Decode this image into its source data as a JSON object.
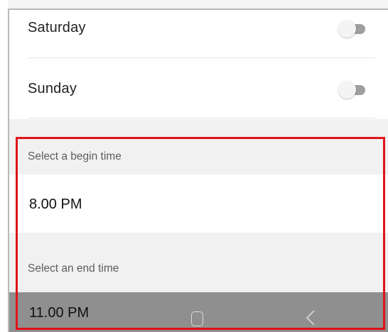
{
  "days": [
    {
      "label": "Saturday",
      "enabled": false,
      "toggle_icon": "toggle-off-icon"
    },
    {
      "label": "Sunday",
      "enabled": false,
      "toggle_icon": "toggle-off-icon"
    }
  ],
  "begin_time": {
    "header": "Select a begin time",
    "value": "8.00 PM"
  },
  "end_time": {
    "header": "Select an end time",
    "value": "11.00 PM"
  },
  "nav": {
    "home_icon": "home-square-icon",
    "back_icon": "back-chevron-icon"
  },
  "highlight_color": "#e0121a"
}
